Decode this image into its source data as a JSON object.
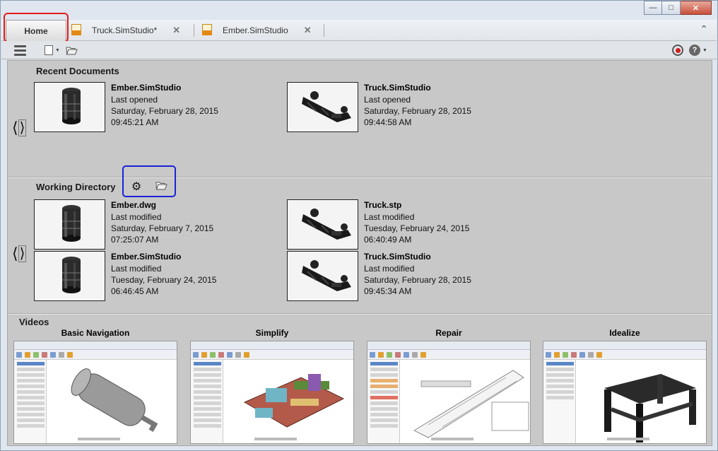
{
  "tabs": [
    {
      "label": "Home"
    },
    {
      "label": "Truck.SimStudio*"
    },
    {
      "label": "Ember.SimStudio"
    }
  ],
  "sections": {
    "recent": {
      "title": "Recent Documents",
      "items": [
        {
          "name": "Ember.SimStudio",
          "status": "Last opened",
          "date": "Saturday, February 28, 2015",
          "time": "09:45:21 AM"
        },
        {
          "name": "Truck.SimStudio",
          "status": "Last opened",
          "date": "Saturday, February 28, 2015",
          "time": "09:44:58 AM"
        }
      ]
    },
    "working": {
      "title": "Working Directory",
      "items": [
        {
          "name": "Ember.dwg",
          "status": "Last modified",
          "date": "Saturday, February 7, 2015",
          "time": "07:25:07 AM"
        },
        {
          "name": "Truck.stp",
          "status": "Last modified",
          "date": "Tuesday, February 24, 2015",
          "time": "06:40:49 AM"
        },
        {
          "name": "Ember.SimStudio",
          "status": "Last modified",
          "date": "Tuesday, February 24, 2015",
          "time": "06:46:45 AM"
        },
        {
          "name": "Truck.SimStudio",
          "status": "Last modified",
          "date": "Saturday, February 28, 2015",
          "time": "09:45:34 AM"
        }
      ]
    },
    "videos": {
      "title": "Videos",
      "items": [
        {
          "title": "Basic Navigation"
        },
        {
          "title": "Simplify"
        },
        {
          "title": "Repair"
        },
        {
          "title": "Idealize"
        }
      ]
    }
  },
  "colors": {
    "home_highlight": "#e01b1b",
    "working_dir_highlight": "#1a22d8",
    "tab_doc_icon": "#e38a14",
    "record_dot": "#d21b1b"
  }
}
